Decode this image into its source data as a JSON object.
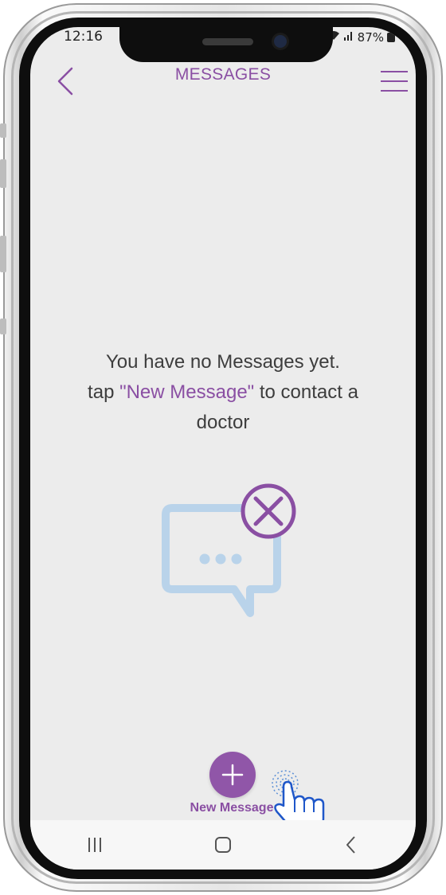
{
  "status_bar": {
    "time": "12:16",
    "battery": "87%"
  },
  "header": {
    "title": "MESSAGES",
    "back_icon": "chevron-left-icon",
    "menu_icon": "hamburger-menu-icon"
  },
  "empty_state": {
    "line1": "You have no Messages yet.",
    "line2_prefix": "tap ",
    "line2_highlight": "\"New Message\"",
    "line2_suffix": " to contact  a",
    "line3": "doctor",
    "icon": "chat-bubble-no-messages-icon"
  },
  "new_message": {
    "label": "New Message",
    "icon": "plus-icon"
  },
  "nav_bar": {
    "recents_icon": "recents-icon",
    "home_icon": "home-icon",
    "back_icon": "back-icon"
  },
  "colors": {
    "accent": "#8a4fa3",
    "fab": "#9056a8",
    "illustration_blue": "#b9d3ea",
    "screen_bg": "#ececec"
  }
}
